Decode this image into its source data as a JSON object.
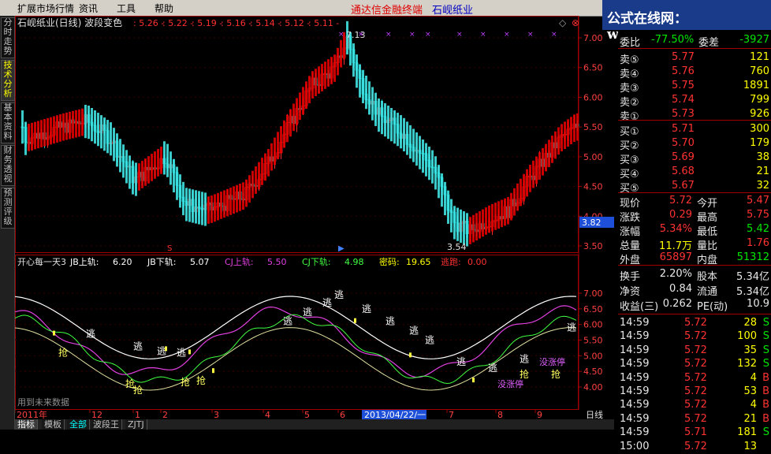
{
  "menu": {
    "items": [
      "扩展市场行情",
      "资讯",
      "工具",
      "帮助"
    ],
    "promo": "通达信金融终端",
    "stock_title": "石岘纸业",
    "logo": "公式在线网：www.gszx.cn"
  },
  "left_tabs": [
    "分时走势",
    "技术分析",
    "基本资料",
    "财务透视",
    "预测评级"
  ],
  "main_chart": {
    "header_name": "石岘纸业(日线) 波段变色",
    "header_values": [
      "5.26",
      "5.22",
      "5.19",
      "5.16",
      "5.14",
      "5.12",
      "5.11"
    ],
    "y_ticks": [
      "7.00",
      "6.50",
      "6.00",
      "5.50",
      "5.00",
      "4.50",
      "4.00",
      "3.50"
    ],
    "high_label": "7.13",
    "low_label": "3.54",
    "cursor_price": "3.82",
    "colors": {
      "up": "#ff2020",
      "down": "#00c8c8",
      "band_red": "#e00000",
      "band_cyan": "#40e0e0"
    }
  },
  "indicator": {
    "header_name": "开心每一天3",
    "params": [
      {
        "label": "JB上轨:",
        "value": "6.20",
        "color": "#ffffff"
      },
      {
        "label": "JB下轨:",
        "value": "5.07",
        "color": "#ffffff"
      },
      {
        "label": "CJ上轨:",
        "value": "5.50",
        "color": "#e040e0"
      },
      {
        "label": "CJ下轨:",
        "value": "4.98",
        "color": "#40ff40"
      },
      {
        "label": "密码:",
        "value": "19.65",
        "color": "#ffff00"
      },
      {
        "label": "逃跑:",
        "value": "0.00",
        "color": "#ff3030"
      }
    ],
    "y_ticks": [
      "7.00",
      "6.50",
      "6.00",
      "5.50",
      "5.00",
      "4.50",
      "4.00"
    ],
    "watermark": "用到未来数据",
    "labels": {
      "escape": "逃",
      "grab": "抢",
      "stop": "没涨停"
    }
  },
  "x_axis": {
    "labels": [
      "2011年",
      "12",
      "1",
      "2",
      "3",
      "4",
      "5",
      "6",
      "7",
      "8",
      "9"
    ],
    "date_box": "2013/04/22/一",
    "period": "日线"
  },
  "bottom_tabs": [
    "指标",
    "模板",
    "全部",
    "波段王",
    "ZJTJ"
  ],
  "panel": {
    "ratio": {
      "label1": "委比",
      "value1": "-77.50%",
      "label2": "委差",
      "value2": "-3927"
    },
    "asks": [
      {
        "label": "卖⑤",
        "price": "5.77",
        "vol": "121"
      },
      {
        "label": "卖④",
        "price": "5.76",
        "vol": "760"
      },
      {
        "label": "卖③",
        "price": "5.75",
        "vol": "1891"
      },
      {
        "label": "卖②",
        "price": "5.74",
        "vol": "799"
      },
      {
        "label": "卖①",
        "price": "5.73",
        "vol": "926"
      }
    ],
    "bids": [
      {
        "label": "买①",
        "price": "5.71",
        "vol": "300"
      },
      {
        "label": "买②",
        "price": "5.70",
        "vol": "179"
      },
      {
        "label": "买③",
        "price": "5.69",
        "vol": "38"
      },
      {
        "label": "买④",
        "price": "5.68",
        "vol": "21"
      },
      {
        "label": "买⑤",
        "price": "5.67",
        "vol": "32"
      }
    ],
    "stats": [
      {
        "l1": "现价",
        "v1": "5.72",
        "c1": "red",
        "l2": "今开",
        "v2": "5.47",
        "c2": "red"
      },
      {
        "l1": "涨跌",
        "v1": "0.29",
        "c1": "red",
        "l2": "最高",
        "v2": "5.75",
        "c2": "red"
      },
      {
        "l1": "涨幅",
        "v1": "5.34%",
        "c1": "red",
        "l2": "最低",
        "v2": "5.42",
        "c2": "grn"
      },
      {
        "l1": "总量",
        "v1": "11.7万",
        "c1": "yel",
        "l2": "量比",
        "v2": "1.76",
        "c2": "red"
      },
      {
        "l1": "外盘",
        "v1": "65897",
        "c1": "red",
        "l2": "内盘",
        "v2": "51312",
        "c2": "grn"
      }
    ],
    "stats2": [
      {
        "l1": "换手",
        "v1": "2.20%",
        "l2": "股本",
        "v2": "5.34亿"
      },
      {
        "l1": "净资",
        "v1": "0.84",
        "l2": "流通",
        "v2": "5.34亿"
      },
      {
        "l1": "收益(三)",
        "v1": "0.262",
        "l2": "PE(动)",
        "v2": "10.9"
      }
    ],
    "ticks": [
      {
        "time": "14:59",
        "price": "5.72",
        "vol": "28",
        "side": "S"
      },
      {
        "time": "14:59",
        "price": "5.72",
        "vol": "100",
        "side": "S"
      },
      {
        "time": "14:59",
        "price": "5.72",
        "vol": "35",
        "side": "S"
      },
      {
        "time": "14:59",
        "price": "5.72",
        "vol": "132",
        "side": "S"
      },
      {
        "time": "14:59",
        "price": "5.72",
        "vol": "4",
        "side": "B"
      },
      {
        "time": "14:59",
        "price": "5.72",
        "vol": "53",
        "side": "B"
      },
      {
        "time": "14:59",
        "price": "5.72",
        "vol": "4",
        "side": "B"
      },
      {
        "time": "14:59",
        "price": "5.72",
        "vol": "21",
        "side": "B"
      },
      {
        "time": "14:59",
        "price": "5.71",
        "vol": "181",
        "side": "S"
      },
      {
        "time": "15:00",
        "price": "5.72",
        "vol": "13",
        "side": ""
      }
    ]
  }
}
